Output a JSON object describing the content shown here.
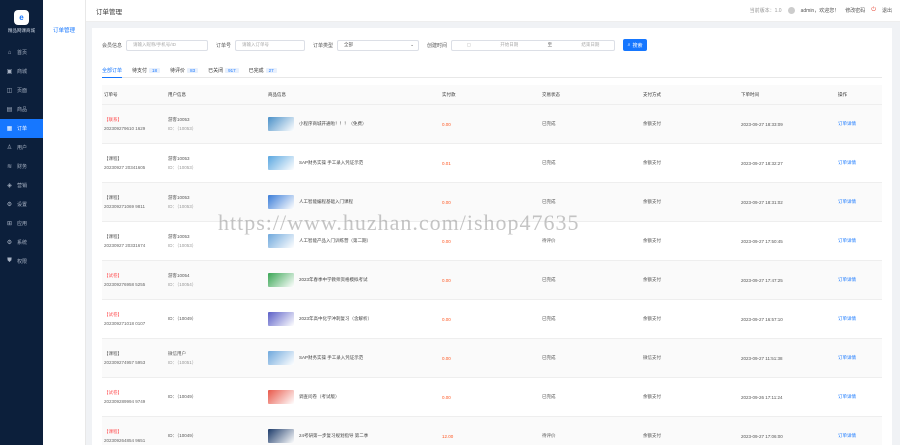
{
  "sidebar": {
    "logo_mark": "e",
    "logo_text": "精品网课商城",
    "items": [
      {
        "icon": "home-icon",
        "glyph": "⌂",
        "label": "首页"
      },
      {
        "icon": "shop-icon",
        "glyph": "▣",
        "label": "商城"
      },
      {
        "icon": "page-icon",
        "glyph": "◫",
        "label": "页面"
      },
      {
        "icon": "goods-icon",
        "glyph": "▤",
        "label": "商品"
      },
      {
        "icon": "order-icon",
        "glyph": "▦",
        "label": "订单",
        "active": true
      },
      {
        "icon": "user-icon",
        "glyph": "♙",
        "label": "用户"
      },
      {
        "icon": "finance-icon",
        "glyph": "≋",
        "label": "财务"
      },
      {
        "icon": "marketing-icon",
        "glyph": "◈",
        "label": "营销"
      },
      {
        "icon": "settings-icon",
        "glyph": "⚙",
        "label": "设置"
      },
      {
        "icon": "app-icon",
        "glyph": "⊞",
        "label": "应用"
      },
      {
        "icon": "system-icon",
        "glyph": "⚙",
        "label": "系统"
      },
      {
        "icon": "permission-icon",
        "glyph": "⛊",
        "label": "权限"
      }
    ]
  },
  "subnav": {
    "item": "订单管理"
  },
  "header": {
    "title": "订单管理",
    "version": "当前版本：1.0",
    "greeting": "admin，欢迎您！",
    "change_pwd": "修改密码",
    "logout": "退出"
  },
  "filters": {
    "member_label": "会员信息",
    "member_placeholder": "请输入昵称/手机号/ID",
    "order_label": "订单号",
    "order_placeholder": "请输入订单号",
    "type_label": "订单类型",
    "type_value": "全部",
    "time_label": "创建时间",
    "start_placeholder": "开始日期",
    "range_sep": "至",
    "end_placeholder": "结束日期",
    "search_label": "搜索"
  },
  "tabs": [
    {
      "label": "全部订单",
      "count": "",
      "active": true
    },
    {
      "label": "待支付",
      "count": "18"
    },
    {
      "label": "待评价",
      "count": "83"
    },
    {
      "label": "已关闭",
      "count": "917"
    },
    {
      "label": "已完成",
      "count": "27"
    }
  ],
  "columns": [
    "订单号",
    "用户信息",
    "商品信息",
    "实付款",
    "交易状态",
    "支付方式",
    "下单时间",
    "操作"
  ],
  "rows": [
    {
      "tag": "【联系】",
      "tag_red": true,
      "order_no": "202309279610 1629",
      "user": "游客10053",
      "uid": "ID：（10053）",
      "thumb": "#4a90c8",
      "goods": "小程序商城开通啦！！！（免费）",
      "amount": "0.00",
      "status": "已完成",
      "pay": "余额支付",
      "time": "2023-09-27 18:33:09",
      "action": "订单详情"
    },
    {
      "tag": "【课程】",
      "tag_red": false,
      "order_no": "20230927 20341605",
      "user": "游客10053",
      "uid": "ID：（10053）",
      "thumb": "#5aa7e0",
      "goods": "SAP财务实操 手工录入凭证示范",
      "amount": "0.01",
      "status": "已完成",
      "pay": "余额支付",
      "time": "2023-09-27 18:32:27",
      "action": "订单详情"
    },
    {
      "tag": "【课程】",
      "tag_red": false,
      "order_no": "202309271069 9811",
      "user": "游客10053",
      "uid": "ID：（10053）",
      "thumb": "#3b7dd8",
      "goods": "人工智能编程基础入门课程",
      "amount": "0.00",
      "status": "已完成",
      "pay": "余额支付",
      "time": "2023-09-27 18:31:02",
      "action": "订单详情"
    },
    {
      "tag": "【课程】",
      "tag_red": false,
      "order_no": "20230927 20331674",
      "user": "游客10053",
      "uid": "ID：（10053）",
      "thumb": "#6fa8dc",
      "goods": "人工智能产品入门训练营（第二期）",
      "amount": "0.00",
      "status": "待评价",
      "pay": "余额支付",
      "time": "2023-09-27 17:50:45",
      "action": "订单详情"
    },
    {
      "tag": "【试卷】",
      "tag_red": true,
      "order_no": "202309276958 5255",
      "user": "游客10054",
      "uid": "ID：（10054）",
      "thumb": "#3aa655",
      "goods": "2023年春季中学教师资格模拟考试",
      "amount": "0.00",
      "status": "已完成",
      "pay": "余额支付",
      "time": "2023-09-27 17:47:25",
      "action": "订单详情"
    },
    {
      "tag": "【试卷】",
      "tag_red": true,
      "order_no": "202309271018 0107",
      "user": "ID：（10049）",
      "uid": "",
      "thumb": "#5b5fc7",
      "goods": "2023年高中化学冲刺复习（含解析）",
      "amount": "0.00",
      "status": "已完成",
      "pay": "余额支付",
      "time": "2023-09-27 16:57:10",
      "action": "订单详情"
    },
    {
      "tag": "【课程】",
      "tag_red": false,
      "order_no": "202309274957 5953",
      "user": "微信用户",
      "uid": "ID：（10051）",
      "thumb": "#6fa8dc",
      "goods": "SAP财务实操 手工录入凭证示范",
      "amount": "0.00",
      "status": "已完成",
      "pay": "微信支付",
      "time": "2023-09-27 11:51:38",
      "action": "订单详情"
    },
    {
      "tag": "【试卷】",
      "tag_red": true,
      "order_no": "202309289994 9749",
      "user": "ID：（10049）",
      "uid": "",
      "thumb": "#e8584a",
      "goods": "调查问卷（考试版）",
      "amount": "0.00",
      "status": "已完成",
      "pay": "余额支付",
      "time": "2023-09-26 17:11:24",
      "action": "订单详情"
    },
    {
      "tag": "【课程】",
      "tag_red": true,
      "order_no": "202309264854 9651",
      "user": "ID：（10049）",
      "uid": "",
      "thumb": "#1d3b6a",
      "goods": "24考研第一步复习规划指导 第二季",
      "amount": "12.00",
      "status": "待评价",
      "pay": "余额支付",
      "time": "2023-09-27 17:06:00",
      "action": "订单详情"
    }
  ],
  "watermark": "https://www.huzhan.com/ishop47635"
}
